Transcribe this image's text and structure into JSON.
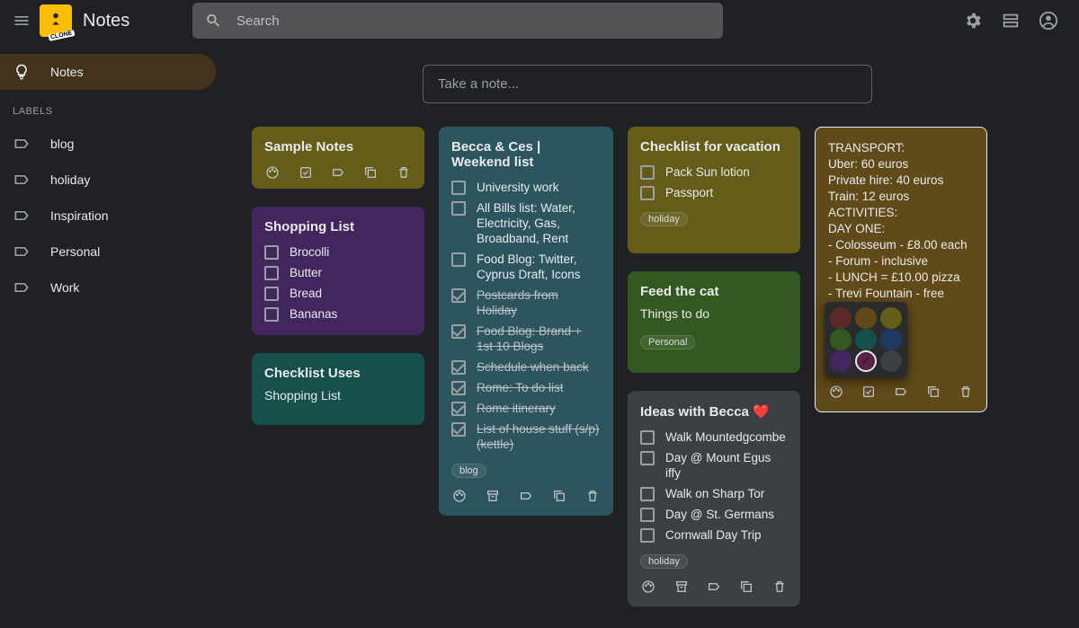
{
  "header": {
    "app_title": "Notes",
    "logo_badge": "CLONE",
    "search_placeholder": "Search"
  },
  "sidebar": {
    "notes_label": "Notes",
    "labels_heading": "LABELS",
    "labels": [
      "blog",
      "holiday",
      "Inspiration",
      "Personal",
      "Work"
    ]
  },
  "take_note_placeholder": "Take a note...",
  "notes": {
    "sample": {
      "title": "Sample Notes"
    },
    "shopping": {
      "title": "Shopping List",
      "items": [
        "Brocolli",
        "Butter",
        "Bread",
        "Bananas"
      ]
    },
    "checklist_uses": {
      "title": "Checklist Uses",
      "body": "Shopping List"
    },
    "weekend": {
      "title": "Becca & Ces | Weekend list",
      "items": [
        {
          "text": "University work",
          "done": false
        },
        {
          "text": "All Bills list: Water, Electricity, Gas, Broadband, Rent",
          "done": false
        },
        {
          "text": "Food Blog: Twitter, Cyprus Draft, Icons",
          "done": false
        },
        {
          "text": "Postcards from Holiday",
          "done": true
        },
        {
          "text": "Food Blog: Brand + 1st 10 Blogs",
          "done": true
        },
        {
          "text": "Schedule when back",
          "done": true
        },
        {
          "text": "Rome: To do list",
          "done": true
        },
        {
          "text": "Rome itinerary",
          "done": true
        },
        {
          "text": "List of house stuff (s/p) (kettle)",
          "done": true
        }
      ],
      "chip": "blog"
    },
    "vacation": {
      "title": "Checklist for vacation",
      "items": [
        "Pack Sun lotion",
        "Passport"
      ],
      "chip": "holiday"
    },
    "feedcat": {
      "title": "Feed the cat",
      "body": "Things to do",
      "chip": "Personal"
    },
    "ideas": {
      "title": "Ideas with Becca ❤️",
      "items": [
        "Walk Mountedgcombe",
        "Day @ Mount Egus iffy",
        "Walk on Sharp Tor",
        "Day @ St. Germans",
        "Cornwall Day Trip"
      ],
      "chip": "holiday"
    },
    "rome": {
      "lines": [
        "TRANSPORT:",
        "Uber: 60 euros",
        "Private hire: 40 euros",
        "Train: 12 euros",
        "ACTIVITIES:",
        "DAY ONE:",
        "- Colosseum - £8.00 each",
        "- Forum - inclusive",
        "- LUNCH = £10.00 pizza",
        "- Trevi Fountain - free"
      ]
    }
  },
  "palette_colors": [
    [
      "#5c2b29",
      "#614a19",
      "#635d19"
    ],
    [
      "#345920",
      "#16504b",
      "#1e3a5f"
    ],
    [
      "#42275e",
      "#5b2245",
      "#3c3f43"
    ]
  ],
  "palette_selected_index": 7
}
